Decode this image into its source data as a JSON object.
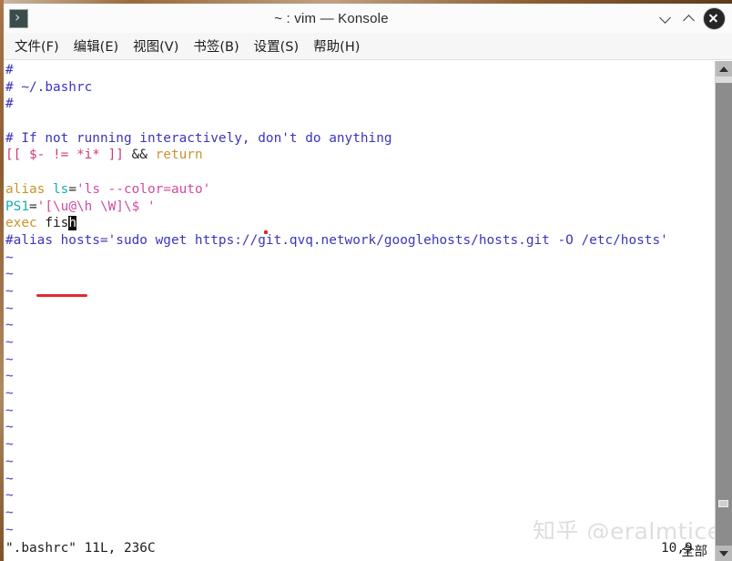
{
  "window": {
    "title": "~ : vim — Konsole",
    "app_icon": "terminal-prompt-icon",
    "controls": {
      "minimize": "chevron-down-icon",
      "maximize": "chevron-up-icon",
      "close": "close-icon"
    }
  },
  "menubar": {
    "items": [
      {
        "label": "文件(F)"
      },
      {
        "label": "编辑(E)"
      },
      {
        "label": "视图(V)"
      },
      {
        "label": "书签(B)"
      },
      {
        "label": "设置(S)"
      },
      {
        "label": "帮助(H)"
      }
    ]
  },
  "editor": {
    "lines": [
      {
        "n": 1,
        "segs": [
          {
            "t": "#",
            "c": "c-comment"
          }
        ]
      },
      {
        "n": 2,
        "segs": [
          {
            "t": "# ~/.bashrc",
            "c": "c-comment"
          }
        ]
      },
      {
        "n": 3,
        "segs": [
          {
            "t": "#",
            "c": "c-comment"
          }
        ]
      },
      {
        "n": 4,
        "segs": [
          {
            "t": "",
            "c": "c-plain"
          }
        ]
      },
      {
        "n": 5,
        "segs": [
          {
            "t": "# If not running interactively, don't do anything",
            "c": "c-comment"
          }
        ]
      },
      {
        "n": 6,
        "segs": [
          {
            "t": "[[",
            "c": "c-bracket"
          },
          {
            "t": " $- != *i* ",
            "c": "c-bracket"
          },
          {
            "t": "]]",
            "c": "c-bracket"
          },
          {
            "t": " ",
            "c": "c-plain"
          },
          {
            "t": "&&",
            "c": "c-op"
          },
          {
            "t": " ",
            "c": "c-plain"
          },
          {
            "t": "return",
            "c": "c-kw"
          }
        ]
      },
      {
        "n": 7,
        "segs": [
          {
            "t": "",
            "c": "c-plain"
          }
        ]
      },
      {
        "n": 8,
        "segs": [
          {
            "t": "alias",
            "c": "c-kw"
          },
          {
            "t": " ",
            "c": "c-plain"
          },
          {
            "t": "ls",
            "c": "c-ident"
          },
          {
            "t": "=",
            "c": "c-op"
          },
          {
            "t": "'ls --color=auto'",
            "c": "c-str"
          }
        ]
      },
      {
        "n": 9,
        "segs": [
          {
            "t": "PS1",
            "c": "c-ident"
          },
          {
            "t": "=",
            "c": "c-op"
          },
          {
            "t": "'[\\u@\\h \\W]\\$ '",
            "c": "c-str"
          }
        ]
      },
      {
        "n": 10,
        "segs": [
          {
            "t": "exec",
            "c": "c-kw"
          },
          {
            "t": " ",
            "c": "c-plain"
          },
          {
            "t": "fis",
            "c": "c-plain"
          },
          {
            "t": "h",
            "c": "cursor"
          }
        ]
      },
      {
        "n": 11,
        "segs": [
          {
            "t": "#alias hosts='sudo wget https://git.qvq.network/googlehosts/hosts.git -O /etc/hosts'",
            "c": "c-comment"
          }
        ]
      }
    ],
    "empty_marker": "~",
    "empty_marker_count": 17
  },
  "annotations": {
    "underline": {
      "target": "fish",
      "color": "#e02a2e"
    },
    "dot": {
      "color": "#d6292f"
    }
  },
  "statusline": {
    "file_info": "\".bashrc\" 11L, 236C",
    "cursor_position": "10,9",
    "scroll_state": "全部"
  },
  "scrollbar": {
    "up_arrow": "triangle-up-icon",
    "down_arrow": "triangle-down-icon"
  },
  "watermark": {
    "text": "知乎 @eralmtice"
  }
}
